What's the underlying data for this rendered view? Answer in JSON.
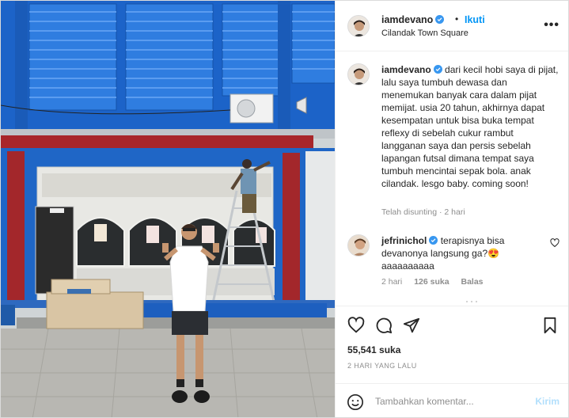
{
  "post": {
    "author": {
      "username": "iamdevano",
      "verified": true,
      "follow_label": "Ikuti",
      "separator": "•",
      "location": "Cilandak Town Square"
    },
    "caption": {
      "username": "iamdevano",
      "text": "dari kecil hobi saya di pijat, lalu saya tumbuh dewasa dan menemukan banyak cara dalam pijat memijat. usia 20 tahun, akhirnya dapat kesempatan untuk bisa buka tempat reflexy di sebelah cukur rambut langganan saya dan persis sebelah lapangan futsal dimana tempat saya tumbuh mencintai sepak bola. anak cilandak. lesgo baby. coming soon!",
      "meta": "Telah disunting · 2 hari"
    },
    "comments": [
      {
        "username": "jefrinichol",
        "verified": true,
        "text": "terapisnya bisa devanonya langsung ga?😍 aaaaaaaaaa",
        "time": "2 hari",
        "likes": "126 suka",
        "reply_label": "Balas"
      }
    ],
    "likes": "55,541 suka",
    "date": "2 HARI YANG LALU",
    "comment_placeholder": "Tambahkan komentar...",
    "post_label": "Kirim"
  },
  "icons": {
    "verified": "verified-badge-icon",
    "more": "more-options-icon",
    "like": "heart-icon",
    "comment": "comment-icon",
    "share": "send-icon",
    "save": "bookmark-icon",
    "emoji": "emoji-icon"
  },
  "colors": {
    "accent": "#0095f6",
    "verified": "#3897f0",
    "muted": "#8e8e8e",
    "post_disabled": "#b2dffc"
  }
}
